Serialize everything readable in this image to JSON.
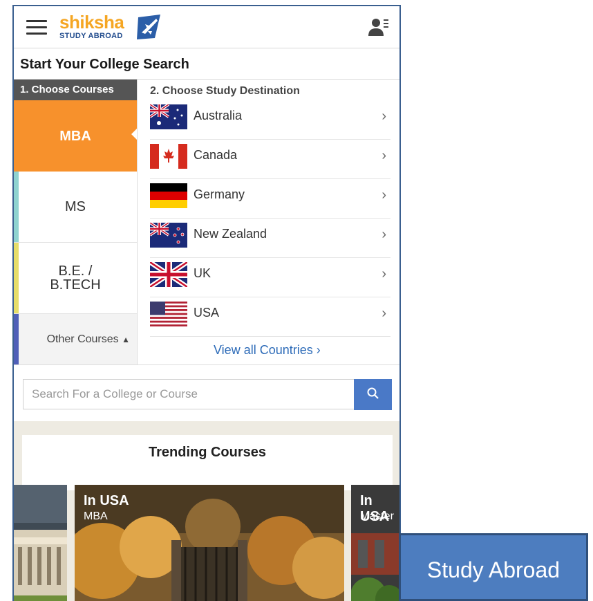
{
  "header": {
    "logo_word": "shiksha",
    "logo_sub": "STUDY ABROAD"
  },
  "search_title": "Start Your College Search",
  "courses": {
    "heading": "1. Choose Courses",
    "items": [
      {
        "label": "MBA",
        "accent": "#f7912c",
        "active": true
      },
      {
        "label": "MS",
        "accent": "#8fd3d0",
        "active": false
      },
      {
        "label": "B.E. / B.TECH",
        "accent": "#e6dd6a",
        "active": false
      }
    ],
    "other_label": "Other Courses",
    "other_accent": "#4f5fb8"
  },
  "destinations": {
    "heading": "2. Choose Study Destination",
    "countries": [
      {
        "name": "Australia",
        "flag": "australia-flag-icon"
      },
      {
        "name": "Canada",
        "flag": "canada-flag-icon"
      },
      {
        "name": "Germany",
        "flag": "germany-flag-icon"
      },
      {
        "name": "New Zealand",
        "flag": "new-zealand-flag-icon"
      },
      {
        "name": "UK",
        "flag": "uk-flag-icon"
      },
      {
        "name": "USA",
        "flag": "usa-flag-icon"
      }
    ],
    "view_all": "View all Countries"
  },
  "search": {
    "placeholder": "Search For a College or Course"
  },
  "trending": {
    "title": "Trending Courses",
    "slides": [
      {
        "country": "",
        "course": ""
      },
      {
        "country": "In USA",
        "course": "MBA"
      },
      {
        "country": "In USA",
        "course": "Master"
      }
    ]
  },
  "overlay_button": "Study Abroad",
  "colors": {
    "accent_orange": "#f7912c",
    "search_button": "#4a79c7",
    "overlay_button": "#4d7dbf"
  }
}
